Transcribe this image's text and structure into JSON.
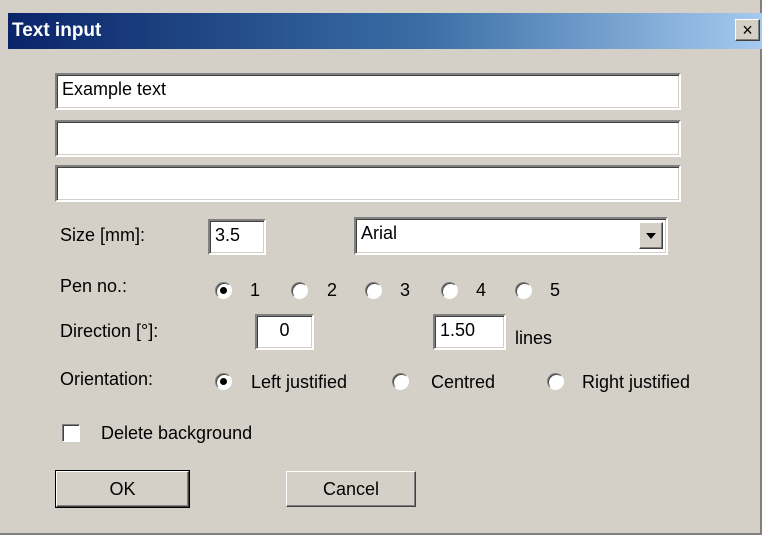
{
  "window": {
    "title": "Text input",
    "close_label": "×"
  },
  "text_lines": [
    "Example text",
    "",
    ""
  ],
  "size": {
    "label": "Size [mm]:",
    "value": "3.5"
  },
  "font": {
    "selected": "Arial"
  },
  "pen": {
    "label": "Pen no.:",
    "options": [
      "1",
      "2",
      "3",
      "4",
      "5"
    ],
    "selected": "1"
  },
  "direction": {
    "label": "Direction [°]:",
    "value": "0",
    "spacing_value": "1.50",
    "spacing_unit": "lines"
  },
  "orientation": {
    "label": "Orientation:",
    "options": [
      "Left justified",
      "Centred",
      "Right justified"
    ],
    "selected": "Left justified"
  },
  "delete_background": {
    "label": "Delete background",
    "checked": false
  },
  "buttons": {
    "ok": "OK",
    "cancel": "Cancel"
  }
}
